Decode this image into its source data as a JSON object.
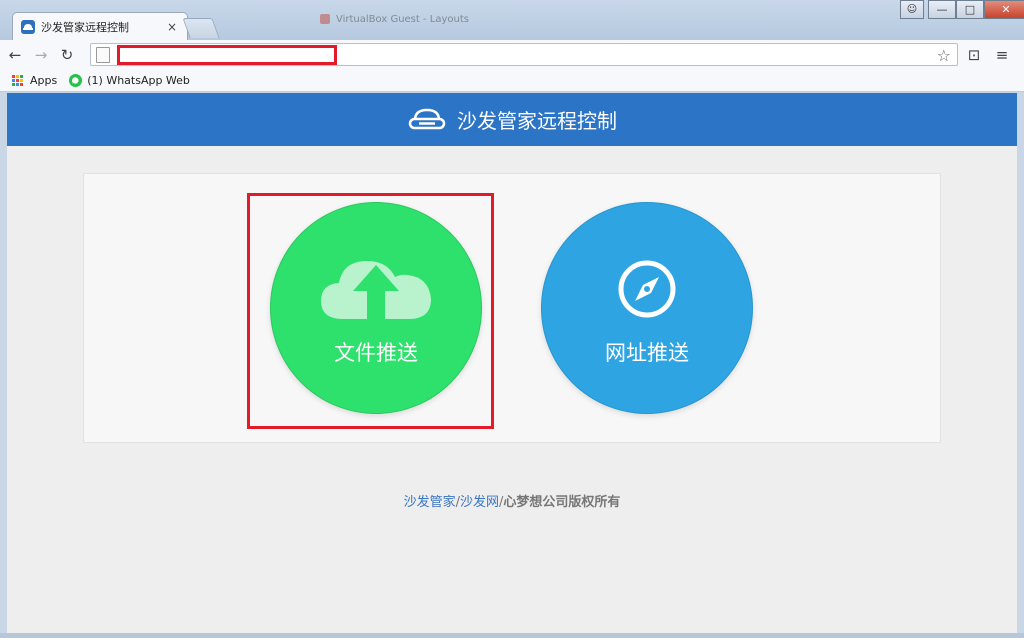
{
  "browser": {
    "tab_title": "沙发管家远程控制",
    "tab_close": "×",
    "ghost_tab_title": "VirtualBox Guest - Layouts",
    "url": "",
    "bookmarks": [
      {
        "label": "Apps",
        "icon": "apps-grid-icon"
      },
      {
        "label": "(1) WhatsApp Web",
        "icon": "whatsapp-icon"
      }
    ]
  },
  "header": {
    "title": "沙发管家远程控制",
    "icon": "sofa-icon"
  },
  "actions": [
    {
      "label": "文件推送",
      "icon": "cloud-upload-icon",
      "color": "#2ee06c"
    },
    {
      "label": "网址推送",
      "icon": "compass-icon",
      "color": "#2ea4e2"
    }
  ],
  "footer": {
    "link1": "沙发管家",
    "sep1": "/",
    "link2": "沙发网",
    "sep2": "/",
    "text": "心梦想公司版权所有"
  },
  "colors": {
    "header_bg": "#2b74c6",
    "highlight": "#e21b2a",
    "green": "#2ee06c",
    "blue": "#2ea4e2"
  }
}
